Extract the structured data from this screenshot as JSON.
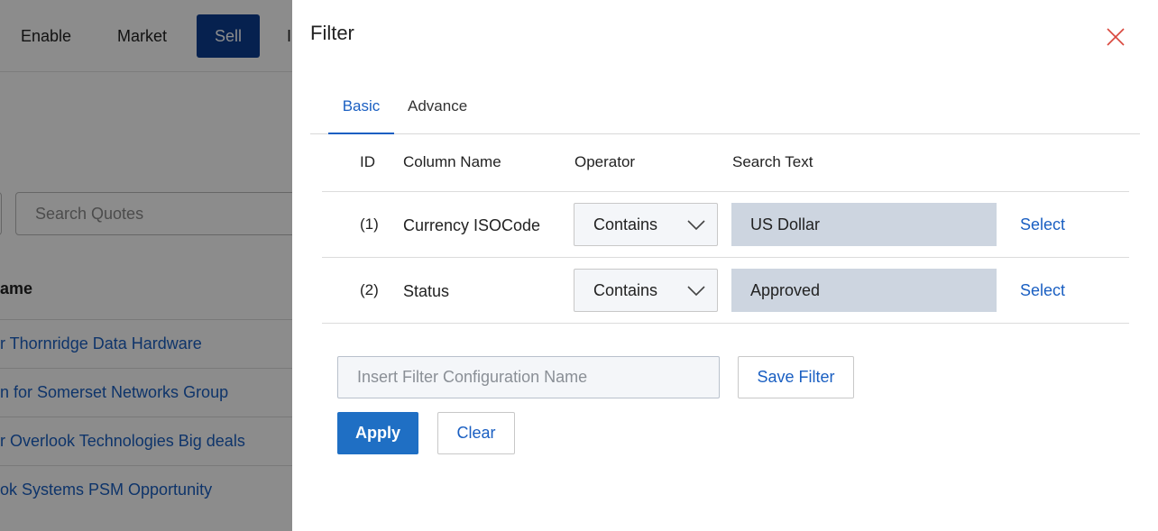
{
  "background": {
    "nav": {
      "enable": "Enable",
      "market": "Market",
      "sell": "Sell",
      "more": "I"
    },
    "search_placeholder": "Search Quotes",
    "column_header": "ame",
    "rows": [
      "r Thornridge Data Hardware",
      "n for Somerset Networks Group",
      "r Overlook Technologies Big deals",
      "ok Systems PSM Opportunity"
    ]
  },
  "drawer": {
    "title": "Filter",
    "close_icon": "close-icon",
    "tabs": {
      "basic": "Basic",
      "advance": "Advance"
    },
    "headers": {
      "id": "ID",
      "column_name": "Column Name",
      "operator": "Operator",
      "search_text": "Search Text"
    },
    "filters": [
      {
        "id": "(1)",
        "column": "Currency ISOCode",
        "operator": "Contains",
        "value": "US Dollar",
        "select": "Select"
      },
      {
        "id": "(2)",
        "column": "Status",
        "operator": "Contains",
        "value": "Approved",
        "select": "Select"
      }
    ],
    "config_placeholder": "Insert Filter Configuration Name",
    "save_filter": "Save Filter",
    "apply": "Apply",
    "clear": "Clear"
  },
  "colors": {
    "accent": "#1a5fc2",
    "primary_button": "#1f6fc4",
    "nav_active": "#0b3d91",
    "close_icon": "#d9463c",
    "search_text_bg": "#cdd5e0"
  }
}
